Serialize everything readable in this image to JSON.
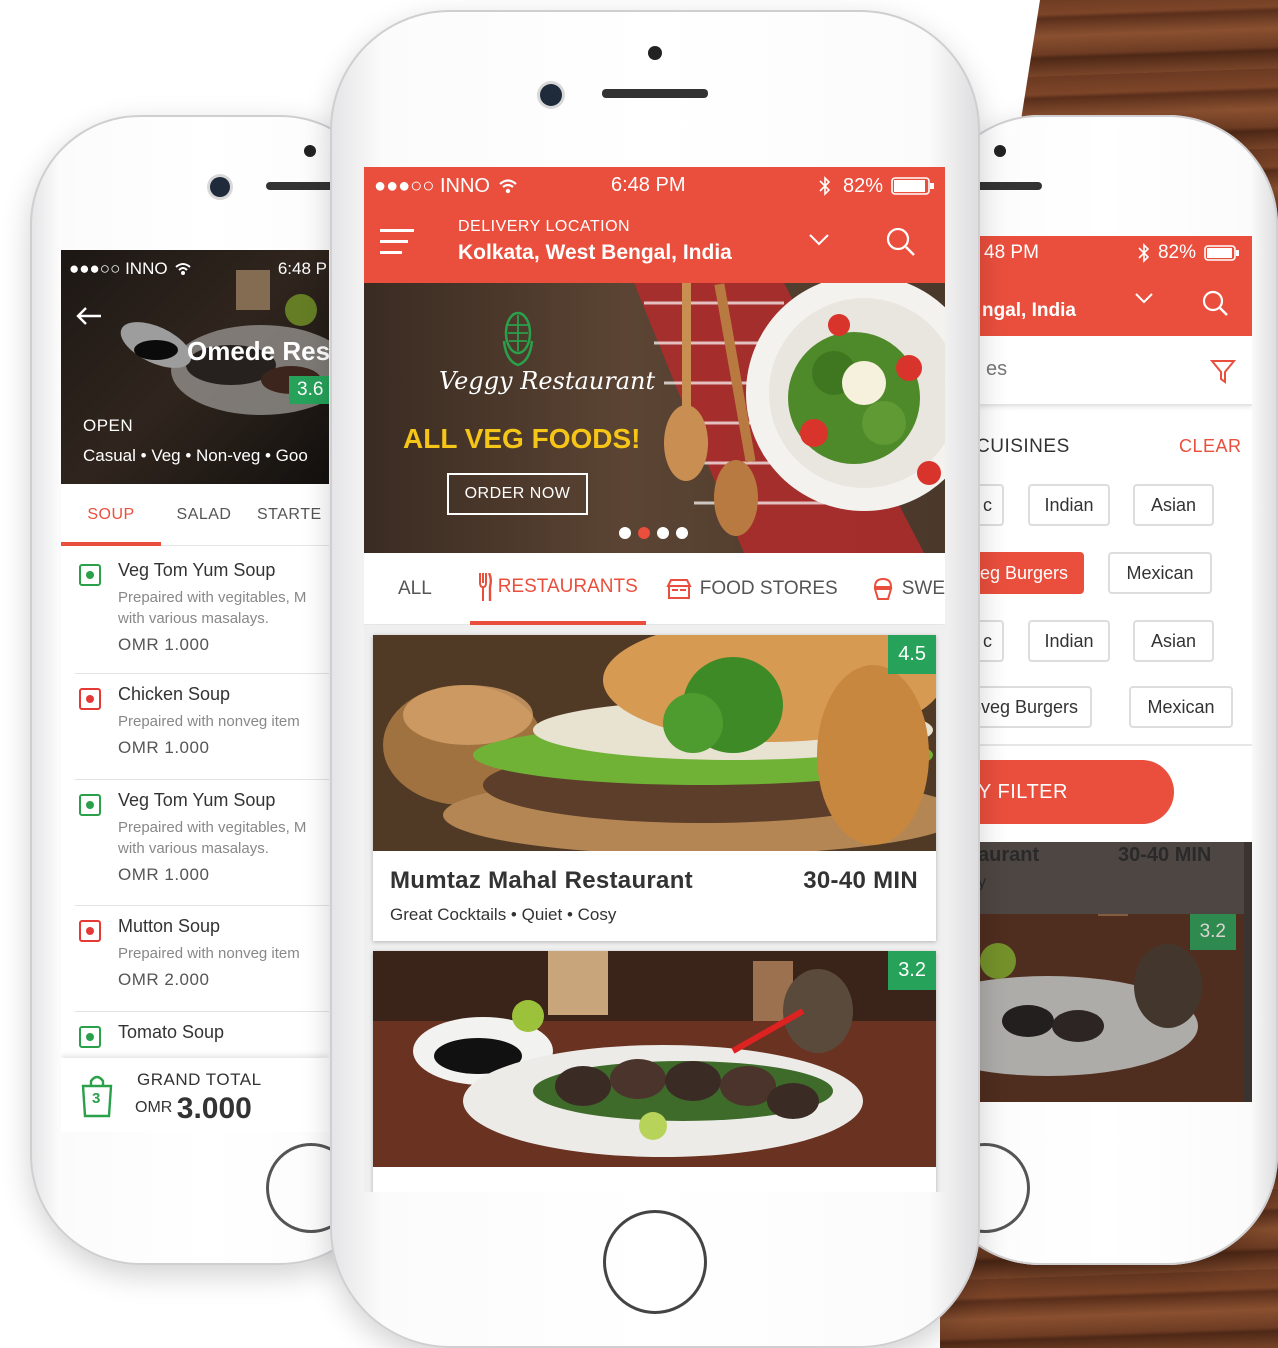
{
  "colors": {
    "accent": "#ea4f3d",
    "rating": "#26a25a",
    "veg": "#2aa04a",
    "nonveg": "#e53935"
  },
  "left": {
    "status": {
      "carrier": "●●●○○ INNO",
      "time": "6:48 P"
    },
    "restaurant_name": "Omede Res",
    "rating": "3.6",
    "open_label": "OPEN",
    "tags": "Casual • Veg • Non-veg • Goo",
    "tabs": [
      "SOUP",
      "SALAD",
      "STARTE"
    ],
    "items": [
      {
        "name": "Veg Tom Yum Soup",
        "desc1": "Prepaired with vegitables, M",
        "desc2": "with various masalays.",
        "price": "OMR 1.000",
        "type": "veg"
      },
      {
        "name": "Chicken Soup",
        "desc1": "Prepaired with nonveg item",
        "desc2": "",
        "price": "OMR 1.000",
        "type": "nonveg"
      },
      {
        "name": "Veg Tom Yum Soup",
        "desc1": "Prepaired with vegitables, M",
        "desc2": "with various masalays.",
        "price": "OMR 1.000",
        "type": "veg"
      },
      {
        "name": "Mutton Soup",
        "desc1": "Prepaired with nonveg item",
        "desc2": "",
        "price": "OMR 2.000",
        "type": "nonveg"
      },
      {
        "name": "Tomato Soup",
        "desc1": "",
        "desc2": "",
        "price": "",
        "type": "veg"
      }
    ],
    "cart_count": "3",
    "grand_total_label": "GRAND TOTAL",
    "currency": "OMR",
    "total": "3.000"
  },
  "center": {
    "status": {
      "carrier": "●●●○○ INNO",
      "time": "6:48 PM",
      "battery": "82%"
    },
    "delivery_label": "DELIVERY LOCATION",
    "location": "Kolkata, West Bengal, India",
    "banner": {
      "brand": "Veggy Restaurant",
      "headline": "ALL VEG FOODS!",
      "cta": "ORDER NOW"
    },
    "tabs": [
      {
        "label": "ALL",
        "icon": "none"
      },
      {
        "label": "RESTAURANTS",
        "icon": "fork-knife-icon"
      },
      {
        "label": "FOOD STORES",
        "icon": "store-icon"
      },
      {
        "label": "SWE",
        "icon": "cupcake-icon"
      }
    ],
    "cards": [
      {
        "rating": "4.5",
        "name": "Mumtaz Mahal Restaurant",
        "time": "30-40 MIN",
        "tags": "Great Cocktails • Quiet • Cosy"
      },
      {
        "rating": "3.2",
        "name": "",
        "time": "",
        "tags": ""
      }
    ]
  },
  "right": {
    "status": {
      "time": "48 PM",
      "battery": "82%"
    },
    "location": "ngal, India",
    "search_partial": "es",
    "cuisines_label": "CUISINES",
    "clear_label": "CLEAR",
    "chips": [
      {
        "label": "c",
        "active": false
      },
      {
        "label": "Indian",
        "active": false
      },
      {
        "label": "Asian",
        "active": false
      },
      {
        "label": "eg Burgers",
        "active": true
      },
      {
        "label": "Mexican",
        "active": false
      },
      {
        "label": "c",
        "active": false
      },
      {
        "label": "Indian",
        "active": false
      },
      {
        "label": "Asian",
        "active": false
      },
      {
        "label": "-veg Burgers",
        "active": false
      },
      {
        "label": "Mexican",
        "active": false
      }
    ],
    "apply_filter": "Y FILTER",
    "bg_card": {
      "name": "aurant",
      "time": "30-40 MIN",
      "sub": "y",
      "rating": "3.2"
    }
  }
}
